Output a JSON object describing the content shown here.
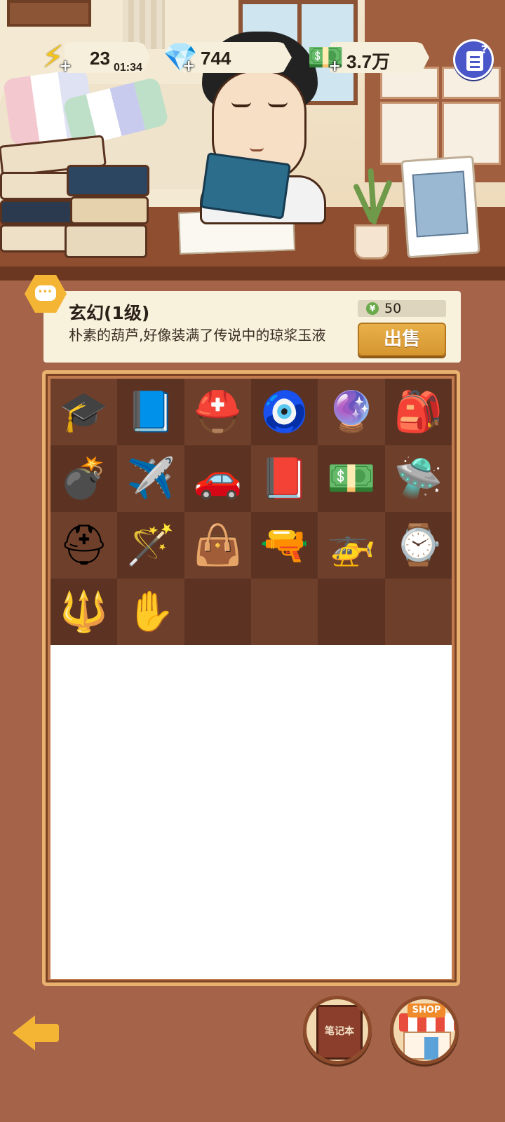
{
  "hud": {
    "energy": {
      "value": "23",
      "timer": "01:34",
      "icon": "lightning-icon",
      "plus": "+"
    },
    "gems": {
      "value": "744",
      "icon": "purple-gem-icon",
      "plus": "+"
    },
    "money": {
      "value": "3.7万",
      "icon": "cash-stack-icon",
      "plus": "+"
    },
    "task_icon": "task-list-icon"
  },
  "item_info": {
    "name": "玄幻(1级)",
    "description": "朴素的葫芦,好像装满了传说中的琼浆玉液",
    "price": "50",
    "price_coin": "¥",
    "sell_label": "出售"
  },
  "inventory": [
    {
      "name": "graduation-cap-icon",
      "glyph": "🎓"
    },
    {
      "name": "magic-book-icon",
      "glyph": "📘"
    },
    {
      "name": "viking-helmet-icon",
      "glyph": "⛑️"
    },
    {
      "name": "jade-pendant-icon",
      "glyph": "🧿"
    },
    {
      "name": "crystal-ball-icon",
      "glyph": "🔮"
    },
    {
      "name": "backpack-icon",
      "glyph": "🎒"
    },
    {
      "name": "cannon-icon",
      "glyph": "💣"
    },
    {
      "name": "toy-plane-icon",
      "glyph": "✈️"
    },
    {
      "name": "sports-car-icon",
      "glyph": "🚗"
    },
    {
      "name": "exam-book-icon",
      "glyph": "📕"
    },
    {
      "name": "banknote-icon",
      "glyph": "💵"
    },
    {
      "name": "ufo-icon",
      "glyph": "🛸"
    },
    {
      "name": "stormtrooper-helmet-icon",
      "glyph": "⛑"
    },
    {
      "name": "magic-staff-icon",
      "glyph": "🪄"
    },
    {
      "name": "handbag-icon",
      "glyph": "👜"
    },
    {
      "name": "pistol-icon",
      "glyph": "🔫"
    },
    {
      "name": "drone-icon",
      "glyph": "🚁"
    },
    {
      "name": "wristwatch-icon",
      "glyph": "⌚"
    },
    {
      "name": "trident-icon",
      "glyph": "🔱"
    },
    {
      "name": "buddha-hand-icon",
      "glyph": "✋"
    },
    {
      "name": "empty-slot",
      "glyph": ""
    },
    {
      "name": "empty-slot",
      "glyph": ""
    },
    {
      "name": "empty-slot",
      "glyph": ""
    },
    {
      "name": "empty-slot",
      "glyph": ""
    }
  ],
  "nav": {
    "notebook_label": "笔记本",
    "shop_label": "SHOP",
    "back_icon": "back-arrow-icon"
  },
  "colors": {
    "background": "#a5644a",
    "accent_gold": "#f5b534",
    "sell_button": "#d69630",
    "task_button": "#4a57c9"
  }
}
